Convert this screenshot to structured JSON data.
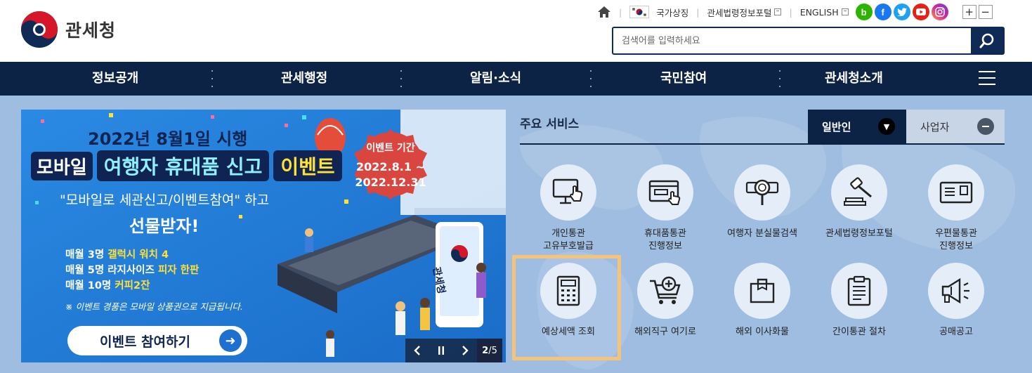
{
  "header": {
    "logo_text": "관세청",
    "util": {
      "home_label": "home",
      "national_symbol": "국가상징",
      "law_portal": "관세법령정보포털",
      "english": "ENGLISH"
    },
    "sns": [
      {
        "name": "blog",
        "letter": "b",
        "color": "#2db400"
      },
      {
        "name": "facebook",
        "letter": "f",
        "color": "#1877f2"
      },
      {
        "name": "twitter",
        "letter": "t",
        "color": "#1da1f2"
      },
      {
        "name": "youtube",
        "letter": "▶",
        "color": "#e62117"
      },
      {
        "name": "instagram",
        "letter": "◎",
        "color": "#c13584"
      }
    ],
    "zoom_in": "+",
    "zoom_out": "−",
    "search": {
      "placeholder": "검색어를 입력하세요",
      "value": ""
    }
  },
  "gnb": {
    "items": [
      "정보공개",
      "관세행정",
      "알림·소식",
      "국민참여",
      "관세청소개"
    ]
  },
  "banner": {
    "line1": "2022년 8월1일 시행",
    "mobile": "모바일",
    "travel": "여행자 휴대품 신고",
    "event": "이벤트",
    "line3": "\"모바일로 세관신고/이벤트참여\" 하고",
    "line4": "선물받자!",
    "prizes": [
      {
        "pre": "매월 3명 ",
        "hl": "갤럭시 워치 4"
      },
      {
        "pre": "매월 5명 라지사이즈 ",
        "hl": "피자 한판"
      },
      {
        "pre": "매월 10명 ",
        "hl": "커피2잔"
      }
    ],
    "notice": "※ 이벤트 경품은 모바일 상품권으로 지급됩니다.",
    "cta": "이벤트 참여하기",
    "badge_title": "이벤트 기간",
    "badge_date1": "2022.8.1 ~",
    "badge_date2": "2022.12.31",
    "kiosk_logo": "관세청",
    "page_current": "2",
    "page_total": "/5"
  },
  "services": {
    "title": "주요 서비스",
    "tab_general": "일반인",
    "tab_business": "사업자",
    "items": [
      {
        "label": "개인통관\n고유부호발급",
        "icon": "monitor-touch-icon"
      },
      {
        "label": "휴대품통관\n진행정보",
        "icon": "browser-hand-icon"
      },
      {
        "label": "여행자 분실물검색",
        "icon": "magnifier-icon"
      },
      {
        "label": "관세법령정보포털",
        "icon": "gavel-icon"
      },
      {
        "label": "우편물통관\n진행정보",
        "icon": "mail-icon"
      },
      {
        "label": "예상세액 조회",
        "icon": "calculator-icon"
      },
      {
        "label": "해외직구 여기로",
        "icon": "cart-plus-icon"
      },
      {
        "label": "해외 이사화물",
        "icon": "box-icon"
      },
      {
        "label": "간이통관 절차",
        "icon": "clipboard-icon"
      },
      {
        "label": "공매공고",
        "icon": "megaphone-icon"
      }
    ]
  }
}
